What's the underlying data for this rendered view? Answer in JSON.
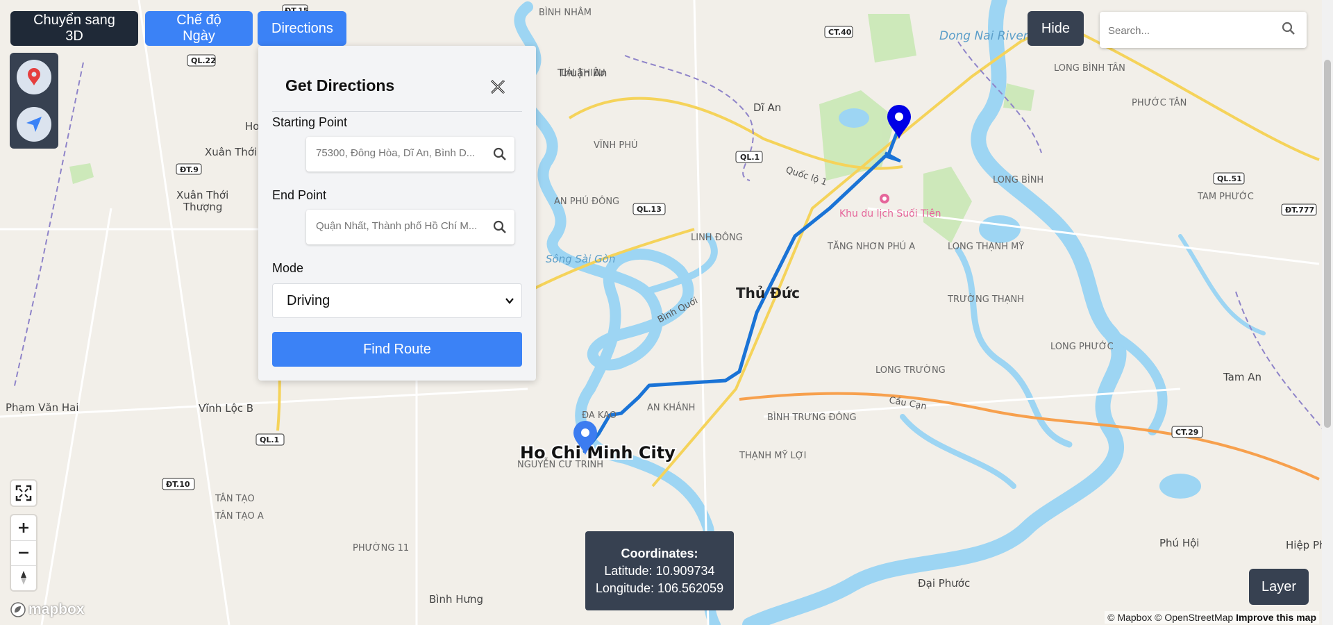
{
  "toolbar": {
    "toggle_3d_label": "Chuyển sang 3D",
    "day_mode_label": "Chế độ Ngày",
    "directions_label": "Directions",
    "hide_label": "Hide"
  },
  "search": {
    "placeholder": "Search..."
  },
  "directions_panel": {
    "title": "Get Directions",
    "starting_label": "Starting Point",
    "starting_value": "75300, Đông Hòa, Dĩ An, Bình D...",
    "end_label": "End Point",
    "end_value": "Quận Nhất, Thành phố Hồ Chí M...",
    "mode_label": "Mode",
    "mode_value": "Driving",
    "find_button": "Find Route"
  },
  "coordinates": {
    "heading": "Coordinates:",
    "latitude_text": "Latitude: 10.909734",
    "longitude_text": "Longitude: 106.562059"
  },
  "layer_label": "Layer",
  "attribution": {
    "mapbox": "© Mapbox",
    "osm": "© OpenStreetMap",
    "improve": "Improve this map"
  },
  "mapbox_logo": "mapbox",
  "map": {
    "city_label": "Ho Chi Minh City",
    "district_label": "Thủ Đức",
    "poi_label": "Khu du lịch Suối Tiên",
    "river_label_1": "Dong Nai River",
    "river_label_2": "Sông Sài Gòn",
    "road_label_1": "Quốc lộ 1",
    "road_label_2": "Cầu Cạn",
    "places": [
      "BÌNH NHÂM",
      "LÁI THIÊU",
      "Thuận An",
      "Dĩ An",
      "LONG BÌNH TÂN",
      "PHƯỚC TÂN",
      "LONG BÌNH",
      "TAM PHƯỚC",
      "VĨNH PHÚ",
      "AN PHÚ ĐÔNG",
      "LINH ĐÔNG",
      "TĂNG NHƠN PHÚ A",
      "LONG THẠNH MỸ",
      "TRƯỜNG THẠNH",
      "LONG PHƯỚC",
      "Tam An",
      "LONG TRƯỜNG",
      "BÌNH TRƯNG ĐÔNG",
      "THẠNH MỸ LỢI",
      "ĐA KAO",
      "AN KHÁNH",
      "NGUYỄN CƯ TRINH",
      "PHƯỜNG 11",
      "Bình Hưng",
      "Đại Phước",
      "Phú Hội",
      "Hiệp Phư",
      "Xuân Thới Sơn",
      "Xuân Thới Thượng",
      "Phạm Văn Hai",
      "Vĩnh Lộc B",
      "TÂN TẠO",
      "TÂN TẠO A",
      "Bình Quới",
      "Ho"
    ],
    "route_badges": [
      "ĐT.15",
      "QL.22",
      "CT.40",
      "QL.1",
      "QL.13",
      "ĐT.9",
      "QL.51",
      "ĐT.777",
      "CT.29",
      "ĐT.10",
      "QL.1"
    ]
  },
  "colors": {
    "dark_button": "#1f2937",
    "blue_button": "#3b82f6",
    "slate": "#374151",
    "route_line": "#1a73d6",
    "water": "#9dd5f3",
    "poi": "#e5659a"
  },
  "icons": [
    "location-pin-icon",
    "navigation-arrow-icon",
    "search-icon",
    "close-icon",
    "chevron-down-icon",
    "fullscreen-icon",
    "zoom-in-icon",
    "zoom-out-icon",
    "compass-icon",
    "destination-marker-icon",
    "origin-marker-icon"
  ]
}
